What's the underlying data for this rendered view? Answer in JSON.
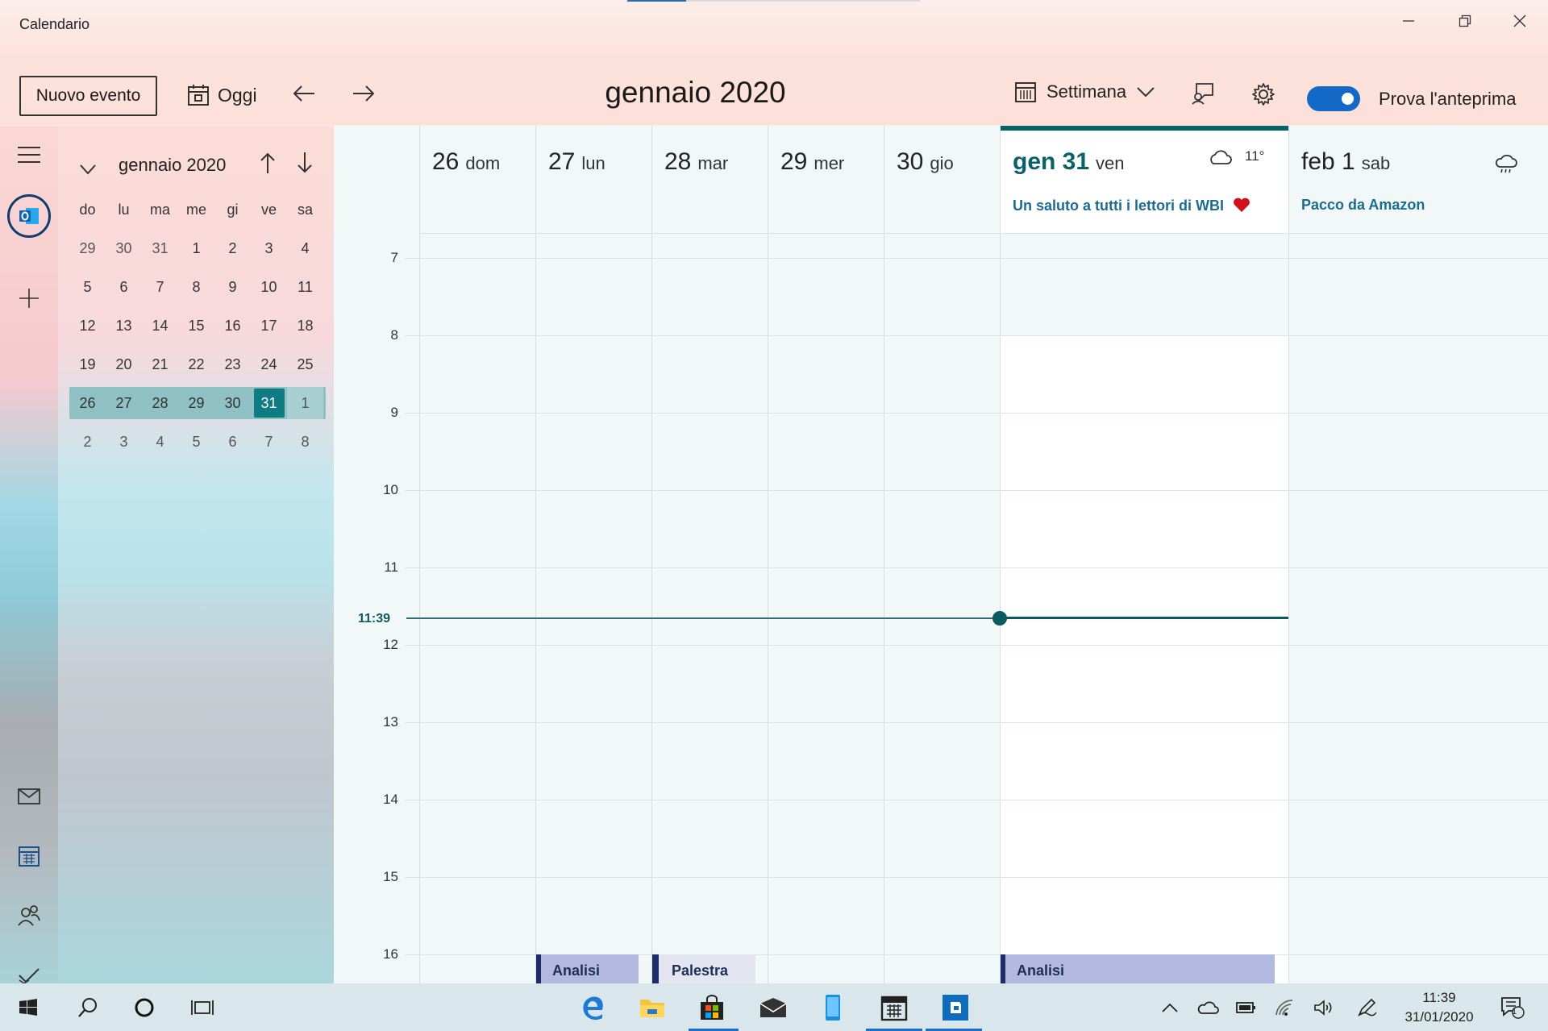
{
  "window": {
    "title": "Calendario",
    "loading_progress": 0.2
  },
  "toolbar": {
    "new_event": "Nuovo evento",
    "today": "Oggi",
    "month_title": "gennaio 2020",
    "view": "Settimana",
    "preview_label": "Prova l'anteprima",
    "preview_on": true
  },
  "mini_calendar": {
    "title": "gennaio 2020",
    "weekdays": [
      "do",
      "lu",
      "ma",
      "me",
      "gi",
      "ve",
      "sa"
    ],
    "weeks": [
      [
        "29",
        "30",
        "31",
        "1",
        "2",
        "3",
        "4"
      ],
      [
        "5",
        "6",
        "7",
        "8",
        "9",
        "10",
        "11"
      ],
      [
        "12",
        "13",
        "14",
        "15",
        "16",
        "17",
        "18"
      ],
      [
        "19",
        "20",
        "21",
        "22",
        "23",
        "24",
        "25"
      ],
      [
        "26",
        "27",
        "28",
        "29",
        "30",
        "31",
        "1"
      ],
      [
        "2",
        "3",
        "4",
        "5",
        "6",
        "7",
        "8"
      ]
    ],
    "today": "31"
  },
  "week": {
    "days": [
      {
        "num": "26",
        "name": "dom"
      },
      {
        "num": "27",
        "name": "lun"
      },
      {
        "num": "28",
        "name": "mar"
      },
      {
        "num": "29",
        "name": "mer"
      },
      {
        "num": "30",
        "name": "gio"
      },
      {
        "num": "gen 31",
        "name": "ven"
      },
      {
        "num": "feb 1",
        "name": "sab"
      }
    ],
    "weather_temp": "11°",
    "allday_events": {
      "fri": "Un saluto a tutti i lettori di WBI",
      "sat": "Pacco da Amazon"
    },
    "hours": [
      "7",
      "8",
      "9",
      "10",
      "11",
      "12",
      "13",
      "14",
      "15",
      "16"
    ],
    "now_time": "11:39",
    "events": {
      "mon": "Analisi",
      "tue": "Palestra",
      "fri": "Analisi"
    }
  },
  "taskbar": {
    "time": "11:39",
    "date": "31/01/2020",
    "notification_count": "1"
  },
  "colors": {
    "accent": "#0b6169",
    "toggle": "#1469c7",
    "event": "#b3b9de"
  }
}
